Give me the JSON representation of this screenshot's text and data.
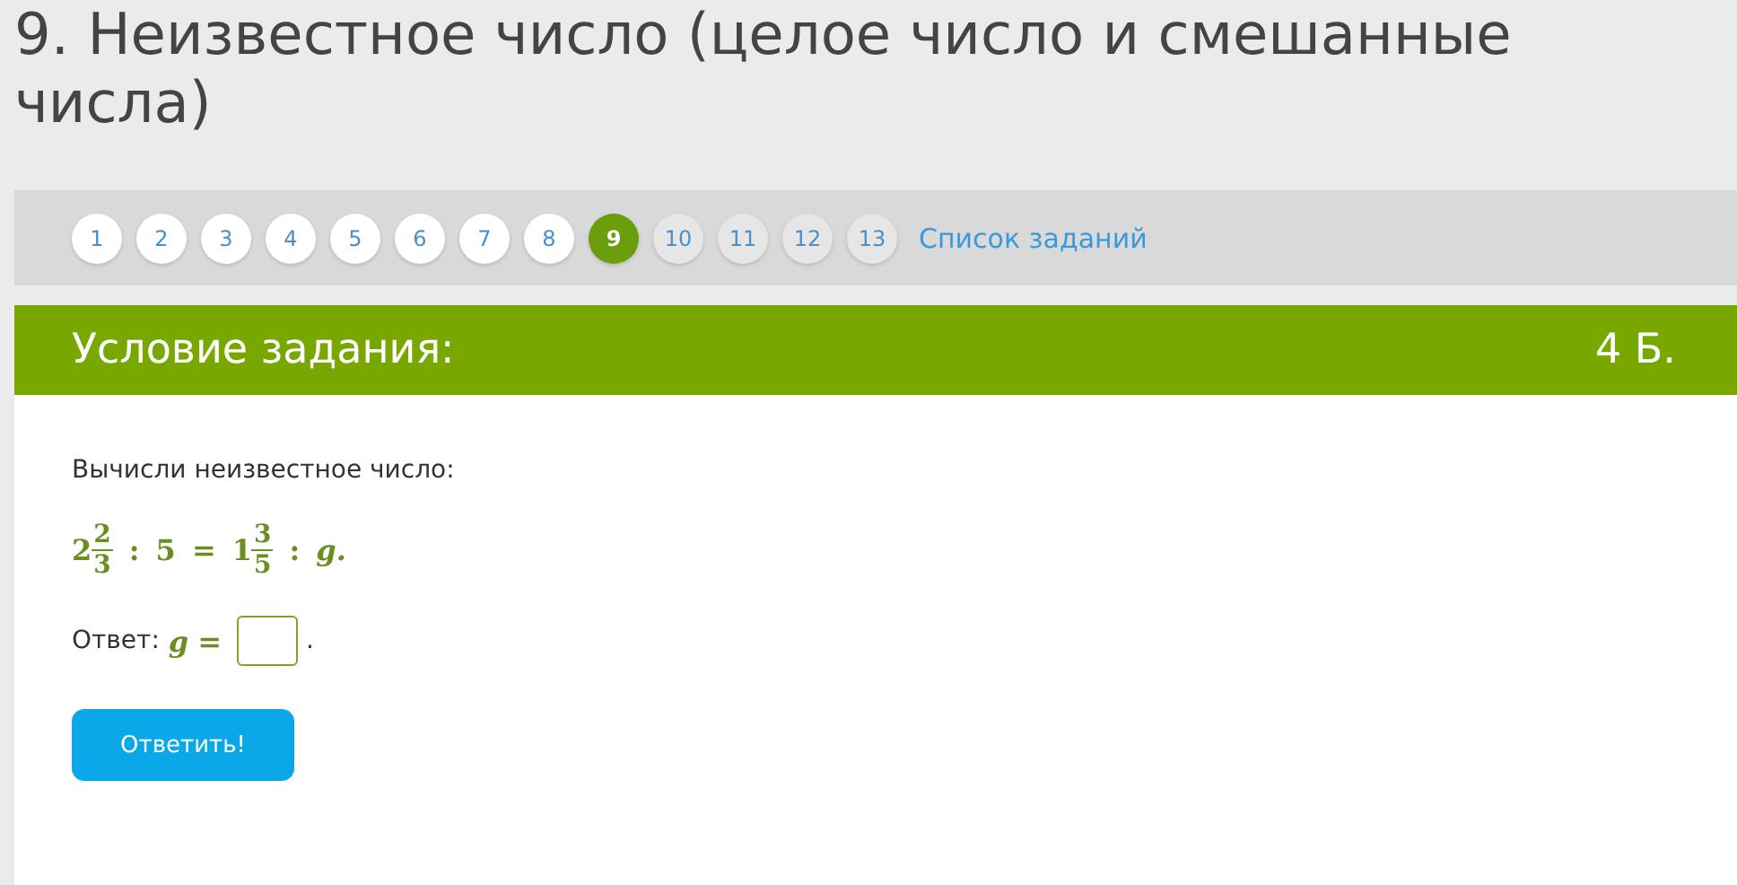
{
  "title": "9. Неизвестное число (целое число и смешанные числа)",
  "pagination": {
    "pages": [
      {
        "label": "1",
        "selected": false,
        "visited": true
      },
      {
        "label": "2",
        "selected": false,
        "visited": true
      },
      {
        "label": "3",
        "selected": false,
        "visited": true
      },
      {
        "label": "4",
        "selected": false,
        "visited": true
      },
      {
        "label": "5",
        "selected": false,
        "visited": true
      },
      {
        "label": "6",
        "selected": false,
        "visited": true
      },
      {
        "label": "7",
        "selected": false,
        "visited": true
      },
      {
        "label": "8",
        "selected": false,
        "visited": true
      },
      {
        "label": "9",
        "selected": true,
        "visited": true
      },
      {
        "label": "10",
        "selected": false,
        "visited": false
      },
      {
        "label": "11",
        "selected": false,
        "visited": false
      },
      {
        "label": "12",
        "selected": false,
        "visited": false
      },
      {
        "label": "13",
        "selected": false,
        "visited": false
      }
    ],
    "list_link": "Список заданий"
  },
  "task": {
    "header": "Условие задания:",
    "points": "4 Б.",
    "prompt": "Вычисли неизвестное число:",
    "formula": [
      {
        "kind": "mixed",
        "whole": "2",
        "numerator": "2",
        "denominator": "3"
      },
      {
        "kind": "op",
        "text": ":"
      },
      {
        "kind": "number",
        "text": "5"
      },
      {
        "kind": "op",
        "text": "="
      },
      {
        "kind": "mixed",
        "whole": "1",
        "numerator": "3",
        "denominator": "5"
      },
      {
        "kind": "op",
        "text": ":"
      },
      {
        "kind": "var",
        "text": "g."
      }
    ],
    "answer": {
      "label": "Ответ:",
      "variable": "g",
      "equals": "=",
      "after": "."
    },
    "submit": "Ответить!"
  }
}
